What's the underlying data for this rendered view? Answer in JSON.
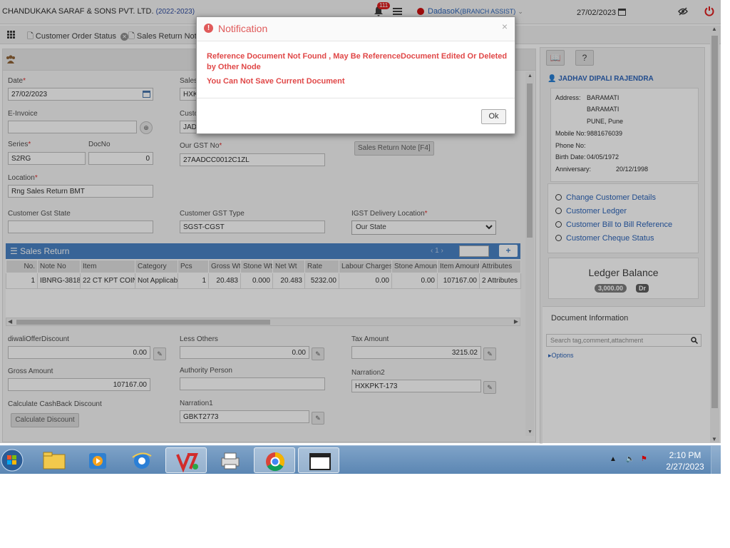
{
  "header": {
    "company": "CHANDUKAKA SARAF & SONS PVT. LTD.",
    "year": "(2022-2023)",
    "notif_count": "111",
    "user": "DadasoK",
    "role": "(BRANCH ASSIST)",
    "date": "27/02/2023"
  },
  "tabs": [
    {
      "label": "Customer Order Status"
    },
    {
      "label": "Sales Return Note"
    }
  ],
  "form": {
    "date_label": "Date",
    "date_value": "27/02/2023",
    "sales_label": "Sales",
    "sales_value": "HXK",
    "einvoice_label": "E-Invoice",
    "cust_label": "Custo",
    "cust_value": "JAD",
    "series_label": "Series",
    "series_value": "S2RG",
    "docno_label": "DocNo",
    "docno_value": "0",
    "gst_label": "Our GST No",
    "gst_value": "27AADCC0012C1ZL",
    "srn_btn": "Sales Return Note [F4]",
    "location_label": "Location",
    "location_value": "Rng Sales Return BMT",
    "cust_gst_state_label": "Customer Gst State",
    "cust_gst_state_value": "",
    "cust_gst_type_label": "Customer GST Type",
    "cust_gst_type_value": "SGST-CGST",
    "igst_label": "IGST Delivery Location",
    "igst_value": "Our State"
  },
  "sales_return": {
    "title": "Sales Return",
    "page": "1",
    "columns": [
      "No.",
      "Note No",
      "Item",
      "Category",
      "Pcs",
      "Gross Wt",
      "Stone Wt",
      "Net Wt",
      "Rate",
      "Labour Charges",
      "Stone Amount",
      "Item Amount",
      "Attributes"
    ],
    "rows": [
      [
        "1",
        "IBNRG-3818",
        "22 CT KPT COIN",
        "Not Applicable",
        "1",
        "20.483",
        "0.000",
        "20.483",
        "5232.00",
        "0.00",
        "0.00",
        "107167.00",
        "2 Attributes"
      ]
    ]
  },
  "footer_form": {
    "diwali_label": "diwaliOfferDiscount",
    "diwali_value": "0.00",
    "less_label": "Less Others",
    "less_value": "0.00",
    "tax_label": "Tax Amount",
    "tax_value": "3215.02",
    "gross_label": "Gross Amount",
    "gross_value": "107167.00",
    "auth_label": "Authority Person",
    "auth_value": "",
    "narr2_label": "Narration2",
    "narr2_value": "HXKPKT-173",
    "cashback_label": "Calculate CashBack Discount",
    "cashback_btn": "Calculate Discount",
    "narr1_label": "Narration1",
    "narr1_value": "GBKT2773"
  },
  "customer": {
    "name": "JADHAV DIPALI RAJENDRA",
    "address_label": "Address:",
    "address_lines": [
      "BARAMATI",
      "BARAMATI",
      "PUNE, Pune"
    ],
    "mobile_label": "Mobile No:",
    "mobile_value": "9881676039",
    "phone_label": "Phone No:",
    "phone_value": "",
    "birth_label": "Birth Date:",
    "birth_value": "04/05/1972",
    "anniv_label": "Anniversary:",
    "anniv_value": "20/12/1998"
  },
  "links": [
    "Change Customer Details",
    "Customer Ledger",
    "Customer Bill to Bill Reference",
    "Customer Cheque Status"
  ],
  "ledger": {
    "title": "Ledger Balance",
    "amount": "3,000.00",
    "type": "Dr"
  },
  "docinfo": {
    "title": "Document Information",
    "search_placeholder": "Search tag,comment,attachment",
    "options": "Options"
  },
  "modal": {
    "title": "Notification",
    "msg1": "Reference Document Not Found , May Be ReferenceDocument Edited Or Deleted by Other Node",
    "msg2": "You Can Not Save Current Document",
    "ok": "Ok",
    "close": "×"
  },
  "taskbar": {
    "time": "2:10 PM",
    "date": "2/27/2023"
  },
  "colors": {
    "accent": "#3f7cc2",
    "error": "#e04848",
    "link": "#1f5bb5"
  }
}
